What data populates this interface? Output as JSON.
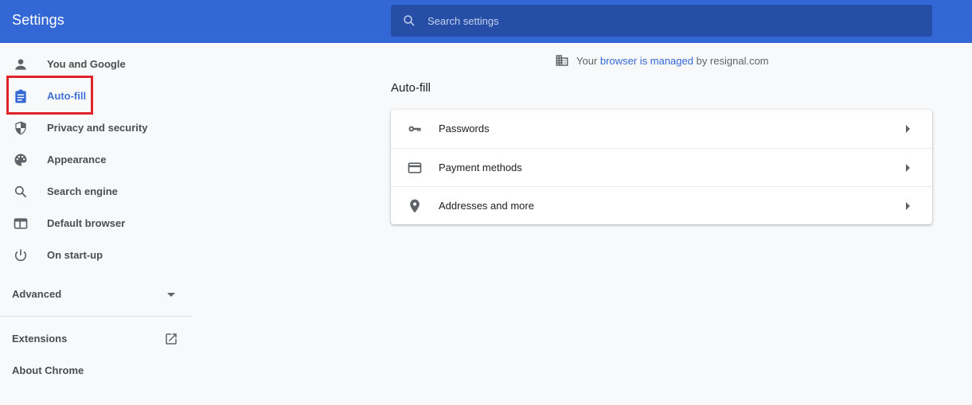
{
  "header": {
    "title": "Settings",
    "search_placeholder": "Search settings",
    "search_value": ""
  },
  "sidebar": {
    "items": [
      {
        "label": "You and Google",
        "icon": "person-icon"
      },
      {
        "label": "Auto-fill",
        "icon": "clipboard-icon",
        "active": true
      },
      {
        "label": "Privacy and security",
        "icon": "shield-icon"
      },
      {
        "label": "Appearance",
        "icon": "palette-icon"
      },
      {
        "label": "Search engine",
        "icon": "search-icon"
      },
      {
        "label": "Default browser",
        "icon": "browser-window-icon"
      },
      {
        "label": "On start-up",
        "icon": "power-icon"
      }
    ],
    "advanced_label": "Advanced",
    "extensions_label": "Extensions",
    "about_label": "About Chrome"
  },
  "managed_notice": {
    "prefix": "Your ",
    "link": "browser is managed",
    "suffix": " by resignal.com"
  },
  "main": {
    "section_title": "Auto-fill",
    "rows": [
      {
        "label": "Passwords",
        "icon": "key-icon"
      },
      {
        "label": "Payment methods",
        "icon": "credit-card-icon"
      },
      {
        "label": "Addresses and more",
        "icon": "location-pin-icon"
      }
    ]
  },
  "colors": {
    "header_bg": "#3367d6",
    "search_bg": "#274ea6",
    "accent": "#3367d6",
    "highlight": "#e0242b"
  }
}
